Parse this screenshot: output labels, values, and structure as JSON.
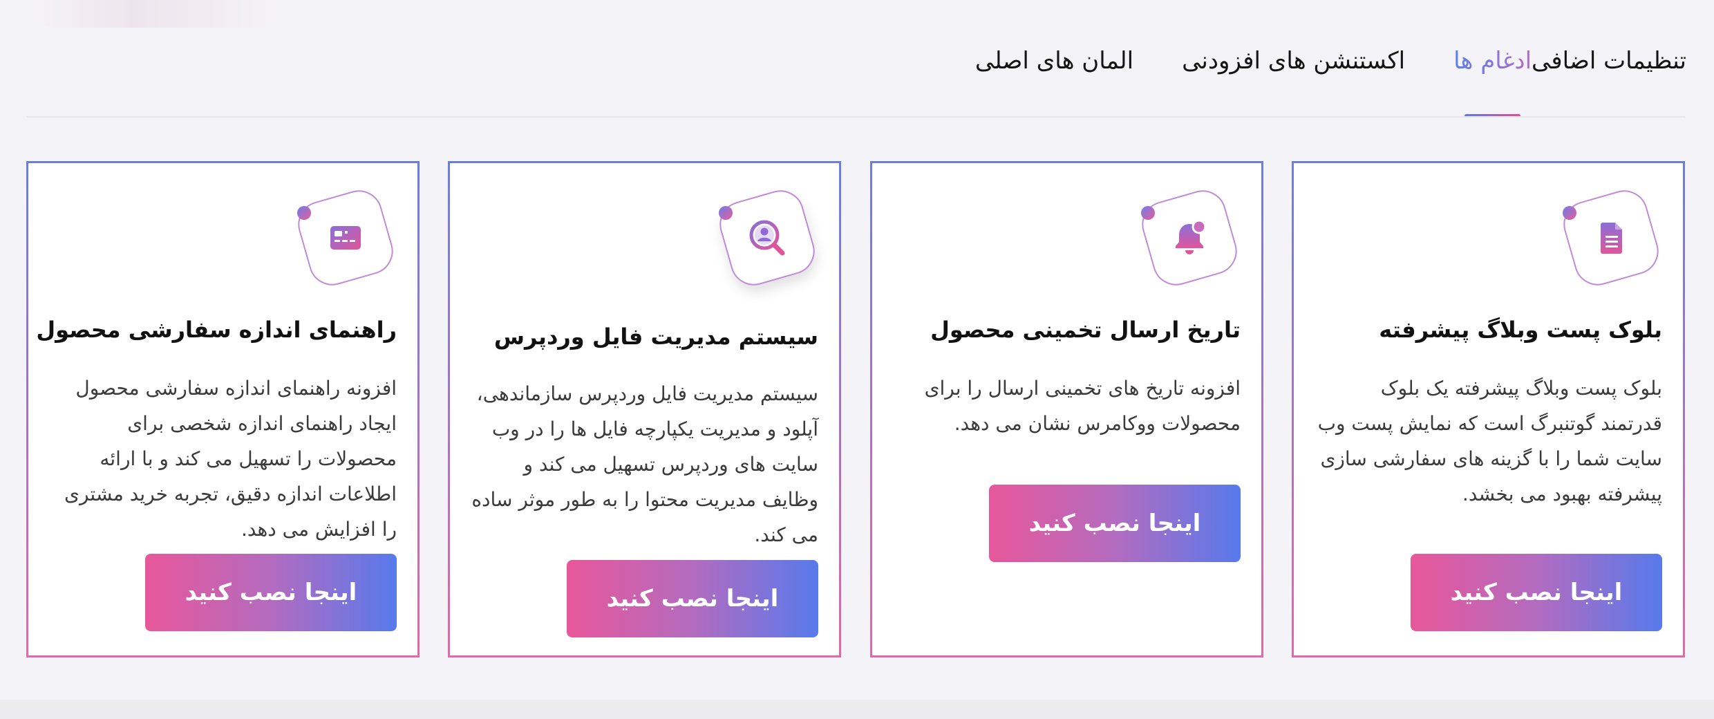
{
  "tabs": [
    {
      "label": "المان های اصلی",
      "active": false
    },
    {
      "label": "اکستنشن های افزودنی",
      "active": false
    },
    {
      "label": "ادغام ها",
      "active": true
    },
    {
      "label": "تنظیمات اضافی",
      "active": false
    }
  ],
  "cards": [
    {
      "icon": "document-icon",
      "title": "بلوک پست وبلاگ پیشرفته",
      "description": "بلوک پست وبلاگ پیشرفته یک بلوک قدرتمند گوتنبرگ است که نمایش پست وب سایت شما را با گزینه های سفارشی سازی پیشرفته بهبود می بخشد.",
      "button": "اینجا نصب کنید"
    },
    {
      "icon": "notification-bell-icon",
      "title": "تاریخ ارسال تخمینی محصول",
      "description": "افزونه تاریخ های تخمینی ارسال را برای محصولات ووکامرس نشان می دهد.",
      "button": "اینجا نصب کنید"
    },
    {
      "icon": "user-search-icon",
      "title": "سیستم مدیریت فایل وردپرس",
      "description": "سیستم مدیریت فایل وردپرس سازماندهی، آپلود و مدیریت یکپارچه فایل ها را در وب سایت های وردپرس تسهیل می کند و وظایف مدیریت محتوا را به طور موثر ساده می کند.",
      "button": "اینجا نصب کنید"
    },
    {
      "icon": "size-card-icon",
      "title": "راهنمای اندازه سفارشی محصول",
      "description": "افزونه راهنمای اندازه سفارشی محصول ایجاد راهنمای اندازه شخصی برای محصولات را تسهیل می کند و با ارائه اطلاعات اندازه دقیق، تجربه خرید مشتری را افزایش می دهد.",
      "button": "اینجا نصب کنید"
    }
  ],
  "colors": {
    "gradient_start": "#577aec",
    "gradient_end": "#e8579a",
    "background": "#f4f4f8"
  }
}
